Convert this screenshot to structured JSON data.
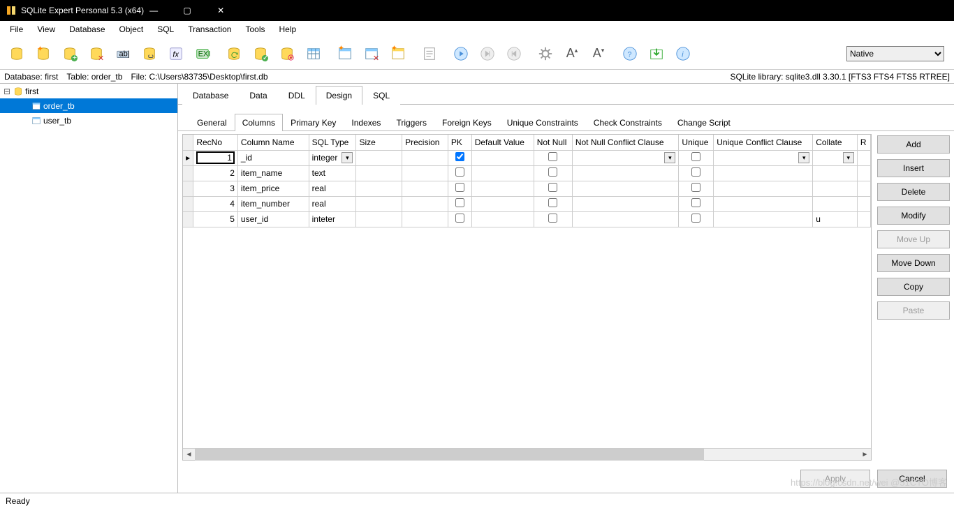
{
  "title": "SQLite Expert Personal 5.3 (x64)",
  "menu": [
    "File",
    "View",
    "Database",
    "Object",
    "SQL",
    "Transaction",
    "Tools",
    "Help"
  ],
  "toolbar_combo": "Native",
  "infobar": {
    "db": "Database: first",
    "table": "Table: order_tb",
    "file": "File: C:\\Users\\83735\\Desktop\\first.db",
    "lib": "SQLite library: sqlite3.dll 3.30.1  [FTS3 FTS4 FTS5 RTREE]"
  },
  "tree": {
    "root": "first",
    "items": [
      "order_tb",
      "user_tb"
    ],
    "selected": "order_tb"
  },
  "tabs": [
    "Database",
    "Data",
    "DDL",
    "Design",
    "SQL"
  ],
  "active_tab": "Design",
  "subtabs": [
    "General",
    "Columns",
    "Primary Key",
    "Indexes",
    "Triggers",
    "Foreign Keys",
    "Unique Constraints",
    "Check Constraints",
    "Change Script"
  ],
  "active_subtab": "Columns",
  "grid": {
    "headers": [
      "RecNo",
      "Column Name",
      "SQL Type",
      "Size",
      "Precision",
      "PK",
      "Default Value",
      "Not Null",
      "Not Null Conflict Clause",
      "Unique",
      "Unique Conflict Clause",
      "Collate",
      "R"
    ],
    "rows": [
      {
        "rec": "1",
        "name": "_id",
        "type": "integer",
        "pk": true,
        "nn": false,
        "uq": false,
        "current": true
      },
      {
        "rec": "2",
        "name": "item_name",
        "type": "text",
        "pk": false,
        "nn": false,
        "uq": false
      },
      {
        "rec": "3",
        "name": "item_price",
        "type": "real",
        "pk": false,
        "nn": false,
        "uq": false
      },
      {
        "rec": "4",
        "name": "item_number",
        "type": "real",
        "pk": false,
        "nn": false,
        "uq": false
      },
      {
        "rec": "5",
        "name": "user_id",
        "type": "inteter",
        "pk": false,
        "nn": false,
        "uq": false,
        "collate": "u"
      }
    ]
  },
  "buttons": {
    "add": "Add",
    "insert": "Insert",
    "delete": "Delete",
    "modify": "Modify",
    "moveup": "Move Up",
    "movedown": "Move Down",
    "copy": "Copy",
    "paste": "Paste"
  },
  "bottom": {
    "apply": "Apply",
    "cancel": "Cancel"
  },
  "status": "Ready",
  "watermark": "https://blog.csdn.net/wei  @51CTO博客"
}
